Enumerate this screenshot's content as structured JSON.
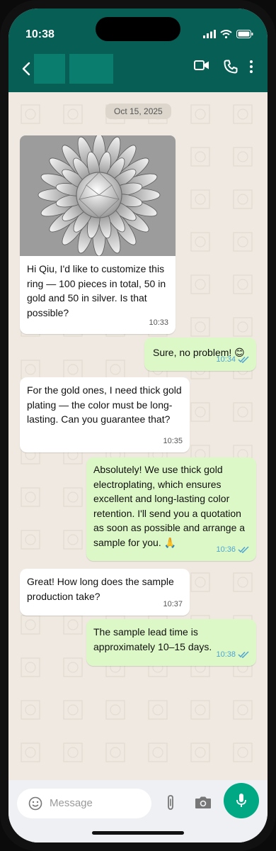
{
  "status_bar": {
    "time": "10:38",
    "icons": [
      "signal-icon",
      "wifi-icon",
      "battery-icon"
    ]
  },
  "header": {
    "back_icon": "chevron-left-icon",
    "actions": [
      "video-call-icon",
      "phone-call-icon",
      "more-vertical-icon"
    ]
  },
  "chat": {
    "date": "Oct 15, 2025",
    "messages": [
      {
        "direction": "in",
        "has_image": true,
        "image_subject": "ring-photo",
        "text": "Hi Qiu, I'd like to customize this ring — 100 pieces in total, 50 in gold and 50 in silver. Is that possible?",
        "time": "10:33"
      },
      {
        "direction": "out",
        "text": "Sure, no problem! 😊",
        "time": "10:34",
        "read": true
      },
      {
        "direction": "in",
        "text": "For the gold ones, I need thick gold plating — the color must be long-lasting. Can you guarantee that?",
        "time": "10:35"
      },
      {
        "direction": "out",
        "text": "Absolutely! We use thick gold electroplating, which ensures excellent and long-lasting color retention. I'll send you a quotation as soon as possible and arrange a sample for you. 🙏",
        "time": "10:36",
        "read": true
      },
      {
        "direction": "in",
        "text": "Great! How long does the sample production take?",
        "time": "10:37"
      },
      {
        "direction": "out",
        "text": "The sample lead time is approximately 10–15 days.",
        "time": "10:38",
        "read": true
      }
    ]
  },
  "input": {
    "placeholder": "Message",
    "icons": [
      "emoji-icon",
      "attach-icon",
      "camera-icon",
      "mic-icon"
    ]
  },
  "colors": {
    "header": "#075e54",
    "outgoing_bubble": "#dcf8c6",
    "incoming_bubble": "#ffffff",
    "chat_background": "#efe9e1",
    "read_ticks": "#4fa3d1",
    "mic_button": "#00a884"
  }
}
